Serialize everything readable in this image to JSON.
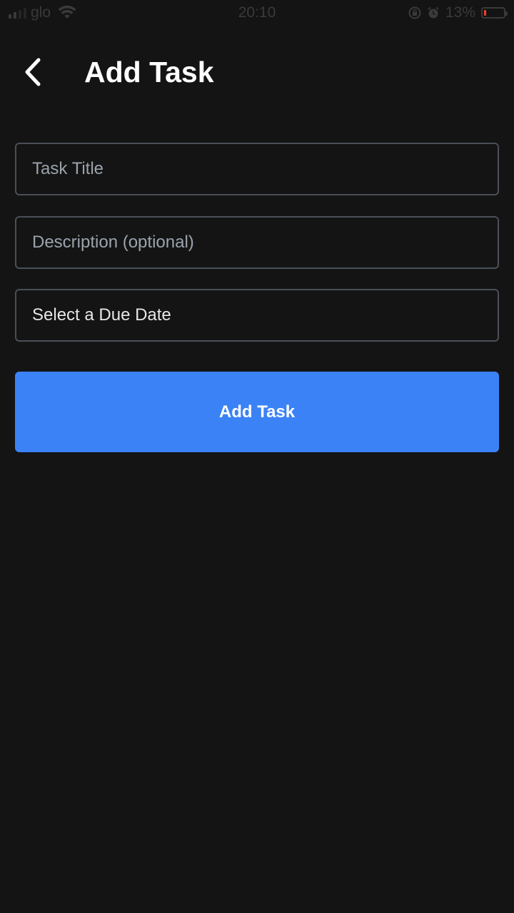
{
  "status_bar": {
    "carrier": "glo",
    "time": "20:10",
    "battery": "13%",
    "battery_level": 0.13,
    "icons": [
      "signal-icon",
      "wifi-icon",
      "lock-rotation-icon",
      "alarm-icon",
      "battery-icon"
    ]
  },
  "header": {
    "title": "Add Task",
    "back_icon": "chevron-left-icon"
  },
  "form": {
    "title_placeholder": "Task Title",
    "title_value": "",
    "description_placeholder": "Description (optional)",
    "description_value": "",
    "due_date_label": "Select a Due Date"
  },
  "actions": {
    "add_label": "Add Task"
  },
  "colors": {
    "background": "#141414",
    "accent": "#3b82f6",
    "field_border": "#4a4f57",
    "placeholder": "#9aa3ad",
    "battery_low": "#ff3b30"
  }
}
